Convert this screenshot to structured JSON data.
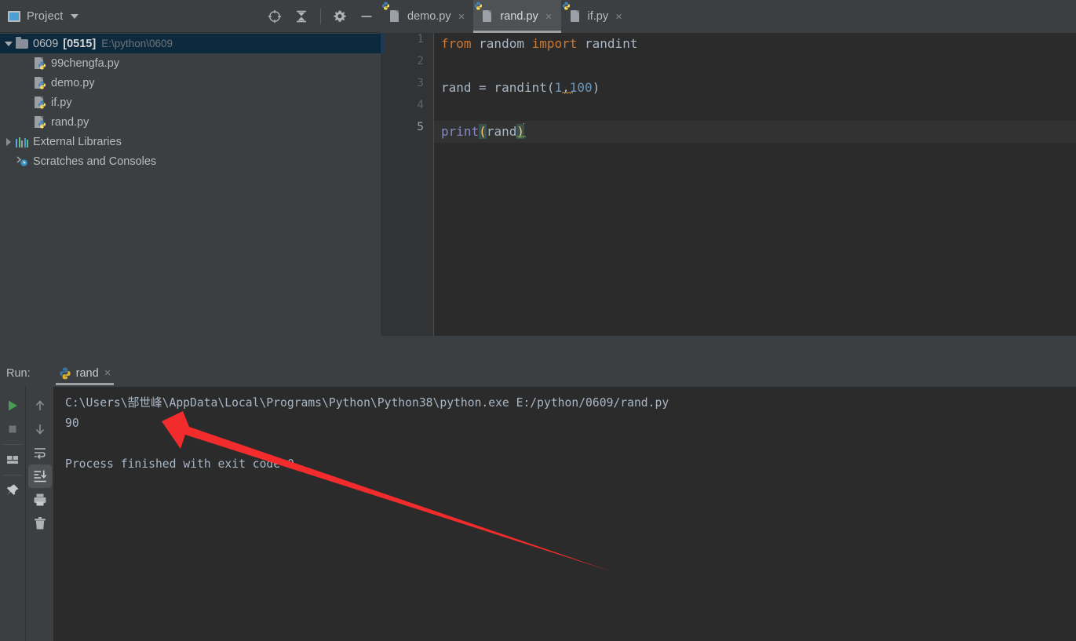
{
  "project": {
    "window_icon": "project-window-icon",
    "title": "Project",
    "caret": "chevron-down-icon",
    "actions": [
      {
        "name": "locate-target-icon",
        "label": "Select Opened File"
      },
      {
        "name": "collapse-all-icon",
        "label": "Collapse All"
      },
      {
        "name": "settings-gear-icon",
        "label": "Settings"
      },
      {
        "name": "hide-minimize-icon",
        "label": "Hide"
      }
    ],
    "tree": [
      {
        "name": "0609",
        "badge": "[0515]",
        "path": "E:\\python\\0609",
        "icon": "folder-icon",
        "type": "folder",
        "selected": true,
        "expanded": true,
        "indent": 0
      },
      {
        "name": "99chengfa.py",
        "badge": "",
        "path": "",
        "icon": "python-file-icon",
        "type": "file",
        "selected": false,
        "indent": 2
      },
      {
        "name": "demo.py",
        "badge": "",
        "path": "",
        "icon": "python-file-icon",
        "type": "file",
        "selected": false,
        "indent": 2
      },
      {
        "name": "if.py",
        "badge": "",
        "path": "",
        "icon": "python-file-icon",
        "type": "file",
        "selected": false,
        "indent": 2
      },
      {
        "name": "rand.py",
        "badge": "",
        "path": "",
        "icon": "python-file-icon",
        "type": "file",
        "selected": false,
        "indent": 2
      },
      {
        "name": "External Libraries",
        "badge": "",
        "path": "",
        "icon": "libraries-icon",
        "type": "node",
        "selected": false,
        "expanded": false,
        "indent": 0
      },
      {
        "name": "Scratches and Consoles",
        "badge": "",
        "path": "",
        "icon": "scratches-icon",
        "type": "node",
        "selected": false,
        "indent": 1
      }
    ]
  },
  "editor": {
    "tabs": [
      {
        "label": "demo.py",
        "icon": "python-file-icon",
        "close": "×",
        "active": false
      },
      {
        "label": "rand.py",
        "icon": "python-file-icon",
        "close": "×",
        "active": true
      },
      {
        "label": "if.py",
        "icon": "python-file-icon",
        "close": "×",
        "active": false
      }
    ],
    "line_numbers": [
      "1",
      "2",
      "3",
      "4",
      "5"
    ],
    "current_line": 5,
    "code": {
      "line1_kw_from": "from",
      "line1_module": " random ",
      "line1_kw_import": "import",
      "line1_name": " randint",
      "line3_lhs": "rand = randint(",
      "line3_num1": "1",
      "line3_comma": ",",
      "line3_num2": "100",
      "line3_close": ")",
      "line5_fn": "print",
      "line5_open": "(",
      "line5_arg": "rand",
      "line5_close": ")"
    }
  },
  "run": {
    "label": "Run:",
    "tab": {
      "label": "rand",
      "icon": "python-file-icon",
      "close": "×"
    },
    "toolbar_left": [
      {
        "name": "run-button-icon",
        "label": "Run"
      },
      {
        "name": "stop-button-icon",
        "label": "Stop"
      },
      {
        "name": "restore-layout-icon",
        "label": "Restore Layout"
      },
      {
        "name": "pin-tab-icon",
        "label": "Pin Tab"
      }
    ],
    "toolbar_right": [
      {
        "name": "up-arrow-icon",
        "label": "Up the Stack Trace"
      },
      {
        "name": "down-arrow-icon",
        "label": "Down the Stack Trace"
      },
      {
        "name": "soft-wrap-icon",
        "label": "Soft-Wrap"
      },
      {
        "name": "scroll-to-end-icon",
        "label": "Scroll to End",
        "active": true
      },
      {
        "name": "print-icon",
        "label": "Print"
      },
      {
        "name": "trash-icon",
        "label": "Clear All"
      }
    ],
    "console": {
      "command": "C:\\Users\\郜世峰\\AppData\\Local\\Programs\\Python\\Python38\\python.exe E:/python/0609/rand.py",
      "output": "90",
      "blank": "",
      "exit": "Process finished with exit code 0"
    }
  },
  "annotation": {
    "name": "red-arrow-annotation",
    "color": "#f22c2c",
    "points_at": "90"
  },
  "colors": {
    "panel_bg": "#3c3f41",
    "editor_bg": "#2b2b2b",
    "gutter_bg": "#313335",
    "selection_bg": "#0d293e",
    "text": "#bbbbbb",
    "keyword": "#cc7832",
    "number": "#6897bb",
    "function": "#8888c6",
    "paren_highlight": "#ffc66d",
    "run_green": "#499c54",
    "arrow_red": "#f22c2c"
  }
}
